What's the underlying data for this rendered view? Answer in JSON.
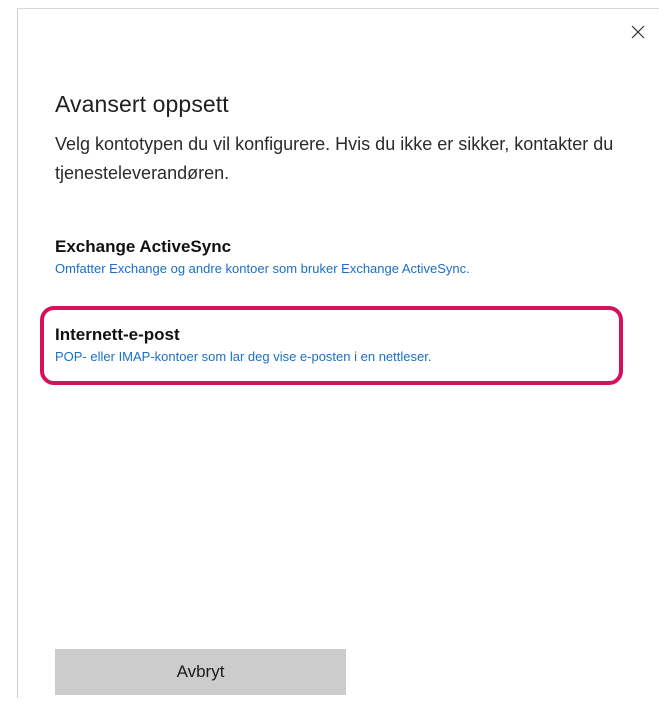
{
  "dialog": {
    "title": "Avansert oppsett",
    "subtitle": "Velg kontotypen du vil konfigurere. Hvis du ikke er sikker, kontakter du tjenesteleverandøren.",
    "close_icon": "close-icon"
  },
  "options": [
    {
      "title": "Exchange ActiveSync",
      "description": "Omfatter Exchange og andre kontoer som bruker Exchange ActiveSync."
    },
    {
      "title": "Internett-e-post",
      "description": "POP- eller IMAP-kontoer som lar deg vise e-posten i en nettleser.",
      "highlighted": true
    }
  ],
  "buttons": {
    "cancel_label": "Avbryt"
  },
  "colors": {
    "link_blue": "#1b6fc4",
    "highlight": "#d6105a",
    "button_bg": "#cccccc"
  }
}
